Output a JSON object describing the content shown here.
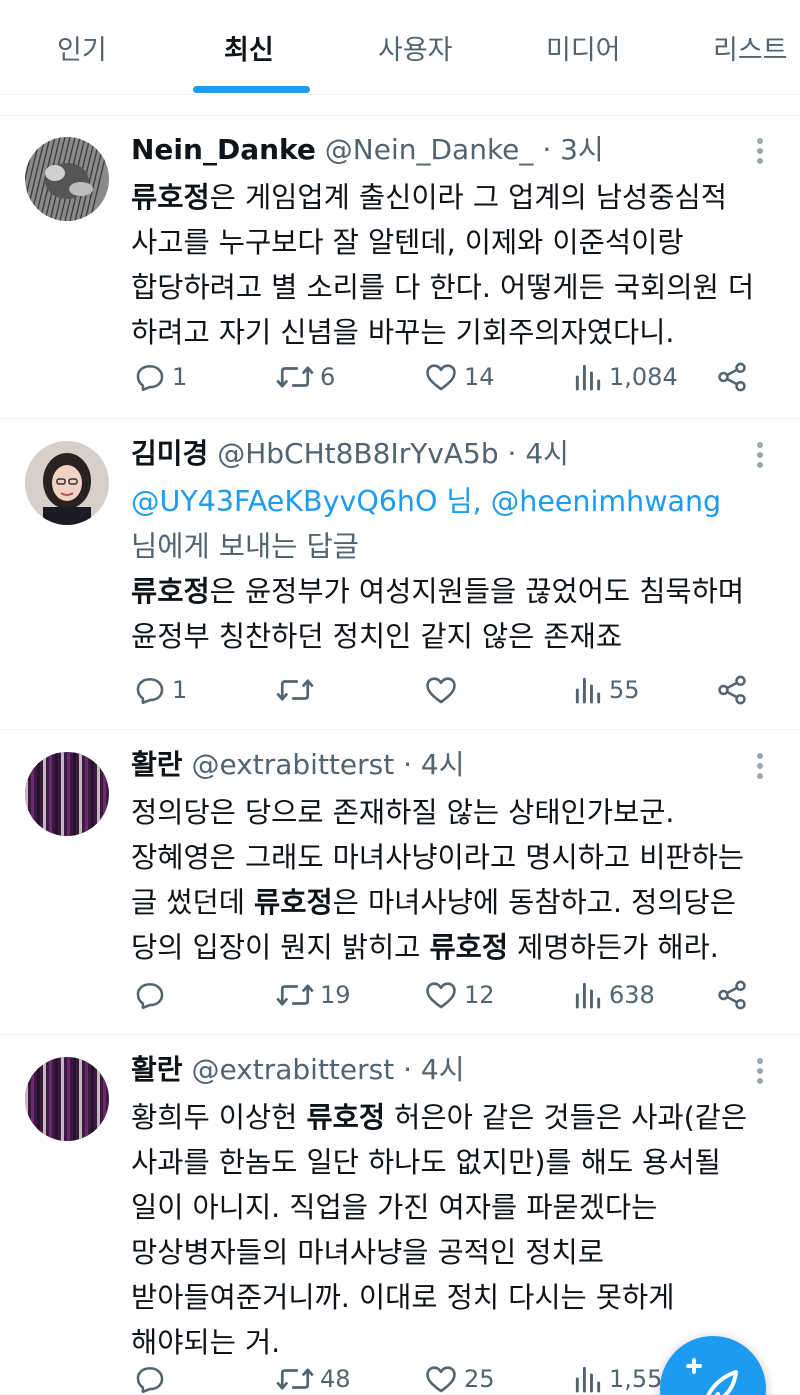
{
  "tabs": [
    "인기",
    "최신",
    "사용자",
    "미디어",
    "리스트"
  ],
  "colors": {
    "accent": "#1d9bf0",
    "text": "#0f1419",
    "muted": "#536471"
  },
  "posts": [
    {
      "name": "Nein_Danke",
      "handle": "@Nein_Danke_",
      "time": "· 3시",
      "avatar": "sketch-illustration-avatar",
      "lines": [
        [
          {
            "b": "류호정"
          },
          {
            "t": "은 게임업계 출신이라 그 업계의 남성중심적"
          }
        ],
        [
          {
            "t": "사고를 누구보다 잘 알텐데, 이제와 이준석이랑"
          }
        ],
        [
          {
            "t": "합당하려고 별 소리를 다 한다. 어떻게든 국회의원 더"
          }
        ],
        [
          {
            "t": "하려고 자기 신념을 바꾸는 기회주의자였다니."
          }
        ]
      ],
      "replies": "1",
      "reposts": "6",
      "likes": "14",
      "views": "1,084"
    },
    {
      "name": "김미경",
      "handle": "@HbCHt8B8IrYvA5b",
      "time": "· 4시",
      "avatar": "woman-portrait-avatar",
      "reply_to": {
        "mentions": "@UY43FAeKByvQ6hO 님, @heenimhwang",
        "suffix": "님에게 보내는 답글"
      },
      "lines": [
        [
          {
            "b": "류호정"
          },
          {
            "t": "은 윤정부가 여성지원들을 끊었어도 침묵하며"
          }
        ],
        [
          {
            "t": "윤정부 칭찬하던 정치인 같지 않은 존재죠"
          }
        ]
      ],
      "replies": "1",
      "reposts": "",
      "likes": "",
      "views": "55"
    },
    {
      "name": "활란",
      "handle": "@extrabitterst",
      "time": "· 4시",
      "avatar": "purple-stripes-avatar",
      "lines": [
        [
          {
            "t": "정의당은 당으로 존재하질 않는 상태인가보군."
          }
        ],
        [
          {
            "t": "장혜영은 그래도 마녀사냥이라고 명시하고 비판하는"
          }
        ],
        [
          {
            "t": "글 썼던데 "
          },
          {
            "b": "류호정"
          },
          {
            "t": "은 마녀사냥에 동참하고. 정의당은"
          }
        ],
        [
          {
            "t": "당의 입장이 뭔지 밝히고 "
          },
          {
            "b": "류호정"
          },
          {
            "t": " 제명하든가 해라."
          }
        ]
      ],
      "replies": "",
      "reposts": "19",
      "likes": "12",
      "views": "638"
    },
    {
      "name": "활란",
      "handle": "@extrabitterst",
      "time": "· 4시",
      "avatar": "purple-stripes-avatar",
      "lines": [
        [
          {
            "t": "황희두 이상헌 "
          },
          {
            "b": "류호정"
          },
          {
            "t": " 허은아  같은 것들은 사과(같은"
          }
        ],
        [
          {
            "t": "사과를 한놈도 일단 하나도 없지만)를 해도 용서될"
          }
        ],
        [
          {
            "t": "일이 아니지. 직업을 가진 여자를  파묻겠다는"
          }
        ],
        [
          {
            "t": "망상병자들의 마녀사냥을 공적인 정치로"
          }
        ],
        [
          {
            "t": "받아들여준거니까.  이대로 정치 다시는 못하게"
          }
        ],
        [
          {
            "t": "해야되는 거."
          }
        ]
      ],
      "replies": "",
      "reposts": "48",
      "likes": "25",
      "views": "1,55"
    }
  ],
  "fab": {
    "icon": "compose-feather-plus-icon"
  }
}
